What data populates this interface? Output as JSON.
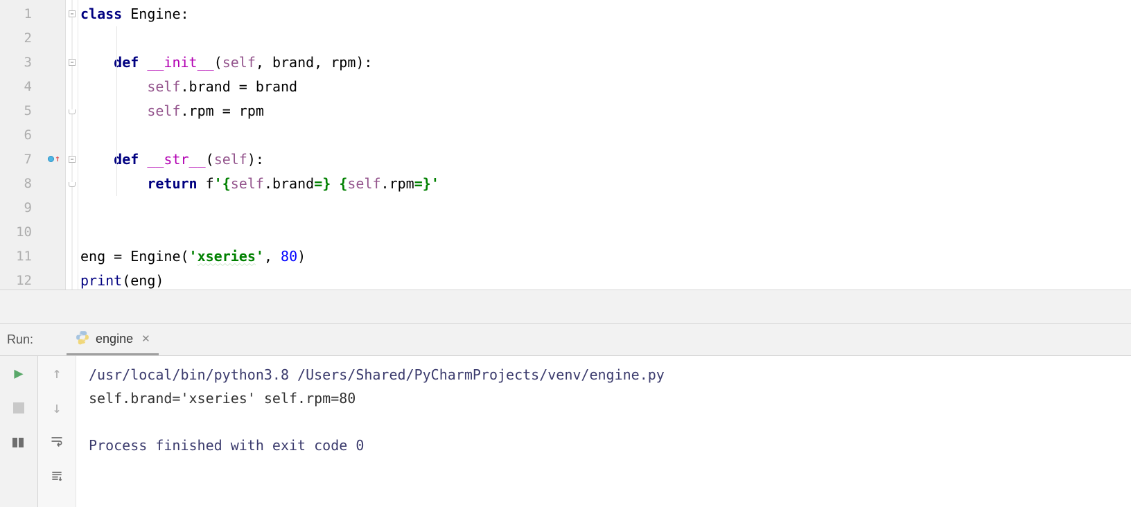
{
  "editor": {
    "line_numbers": [
      "1",
      "2",
      "3",
      "4",
      "5",
      "6",
      "7",
      "8",
      "9",
      "10",
      "11",
      "12"
    ],
    "code": {
      "l1": {
        "kw": "class",
        "sp": " ",
        "name": "Engine",
        "colon": ":"
      },
      "l3": {
        "indent": "    ",
        "kw": "def",
        "sp": " ",
        "name": "__init__",
        "args_open": "(",
        "self": "self",
        "rest": ", brand, rpm):"
      },
      "l4": {
        "indent": "        ",
        "self": "self",
        "rest1": ".brand = brand"
      },
      "l5": {
        "indent": "        ",
        "self": "self",
        "rest1": ".rpm = rpm"
      },
      "l7": {
        "indent": "    ",
        "kw": "def",
        "sp": " ",
        "name": "__str__",
        "args_open": "(",
        "self": "self",
        "rest": "):"
      },
      "l8": {
        "indent": "        ",
        "kw": "return",
        "sp": " ",
        "fpre": "f",
        "q1": "'{",
        "self1": "self",
        "mid1": ".brand",
        "eq1": "=}",
        "sp2": " ",
        "br2": "{",
        "self2": "self",
        "mid2": ".rpm",
        "eq2": "=}",
        "q2": "'"
      },
      "l11": {
        "pre": "eng = Engine(",
        "q": "'",
        "str": "xseries",
        "q2": "'",
        "comma": ", ",
        "num": "80",
        "close": ")"
      },
      "l12": {
        "fn": "print",
        "open": "(",
        "arg": "eng",
        "close": ")"
      }
    }
  },
  "run": {
    "label": "Run:",
    "tab_name": "engine",
    "console": {
      "cmd": "/usr/local/bin/python3.8 /Users/Shared/PyCharmProjects/venv/engine.py",
      "out": "self.brand='xseries' self.rpm=80",
      "exit": "Process finished with exit code 0"
    }
  }
}
